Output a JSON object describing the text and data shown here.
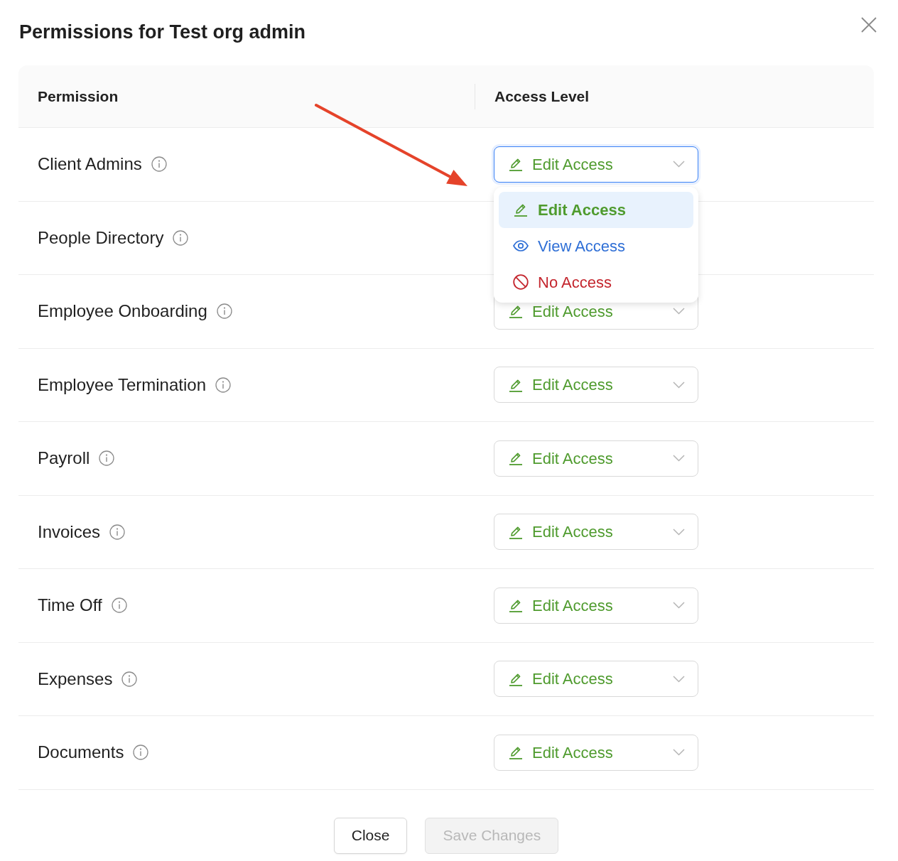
{
  "dialog": {
    "title": "Permissions for Test org admin"
  },
  "table": {
    "columns": [
      "Permission",
      "Access Level"
    ],
    "rows": [
      {
        "permission": "Client Admins",
        "access": {
          "kind": "edit",
          "label": "Edit Access",
          "open": true,
          "options": [
            {
              "kind": "edit",
              "label": "Edit Access",
              "selected": true
            },
            {
              "kind": "view",
              "label": "View Access",
              "selected": false
            },
            {
              "kind": "none",
              "label": "No Access",
              "selected": false
            }
          ]
        }
      },
      {
        "permission": "People Directory"
      },
      {
        "permission": "Employee Onboarding",
        "access": {
          "kind": "edit",
          "label": "Edit Access",
          "open": false
        }
      },
      {
        "permission": "Employee Termination",
        "access": {
          "kind": "edit",
          "label": "Edit Access",
          "open": false
        }
      },
      {
        "permission": "Payroll",
        "access": {
          "kind": "edit",
          "label": "Edit Access",
          "open": false
        }
      },
      {
        "permission": "Invoices",
        "access": {
          "kind": "edit",
          "label": "Edit Access",
          "open": false
        }
      },
      {
        "permission": "Time Off",
        "access": {
          "kind": "edit",
          "label": "Edit Access",
          "open": false
        }
      },
      {
        "permission": "Expenses",
        "access": {
          "kind": "edit",
          "label": "Edit Access",
          "open": false
        }
      },
      {
        "permission": "Documents",
        "access": {
          "kind": "edit",
          "label": "Edit Access",
          "open": false
        }
      }
    ]
  },
  "annotations": [
    {
      "kind": "arrow"
    }
  ],
  "buttons": [
    {
      "label": "Close",
      "disabled": false
    },
    {
      "label": "Save Changes",
      "disabled": true
    }
  ]
}
